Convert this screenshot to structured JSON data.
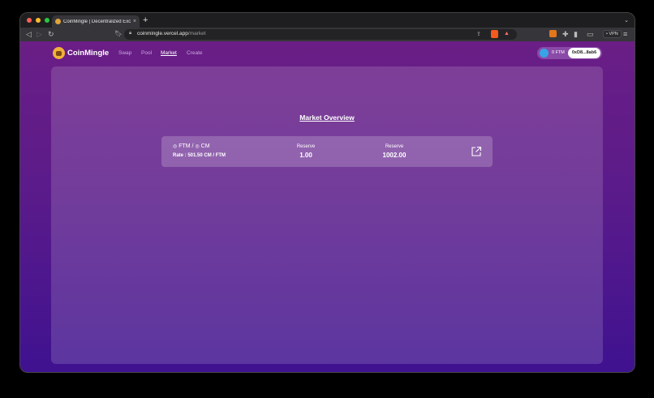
{
  "browser": {
    "tab_title": "CoinMingle | Decentralized Exchange",
    "tab_close": "×",
    "new_tab": "+",
    "url_host": "coinmingle.vercel.app",
    "url_path": "/market",
    "vpn": "• VPN"
  },
  "header": {
    "brand": "CoinMingle",
    "nav": [
      {
        "label": "Swap"
      },
      {
        "label": "Pool"
      },
      {
        "label": "Market"
      },
      {
        "label": "Create"
      }
    ],
    "wallet": {
      "balance": "0 FTM",
      "address": "0xD8...8ab6"
    }
  },
  "market": {
    "title": "Market Overview",
    "pair": {
      "token_a": "FTM",
      "separator": "/",
      "token_b": "CM",
      "rate": "Rate : 501.50 CM / FTM",
      "reserves": [
        {
          "label": "Reserve",
          "value": "1.00"
        },
        {
          "label": "Reserve",
          "value": "1002.00"
        }
      ]
    }
  },
  "colors": {
    "page_top": "#6a1e86",
    "page_bottom": "#3f1290",
    "wallet_icon": "#39a3e8",
    "logo": "#f0b238"
  }
}
